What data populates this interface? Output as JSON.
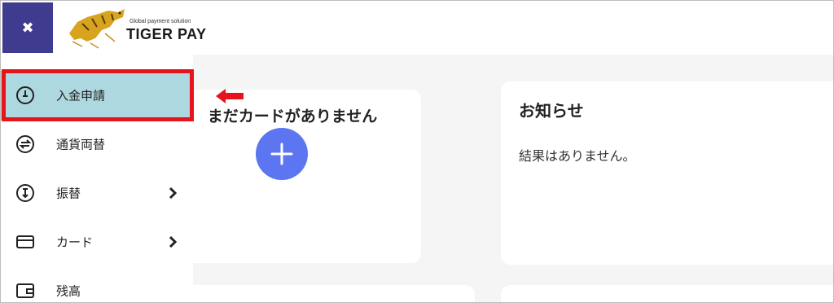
{
  "header": {
    "close_icon": "close-icon",
    "logo_tagline": "Global payment solution",
    "logo_name": "TIGER PAY"
  },
  "sidebar": {
    "items": [
      {
        "label": "入金申請",
        "icon": "deposit-clock-icon",
        "has_submenu": false,
        "active": true
      },
      {
        "label": "通貨両替",
        "icon": "exchange-icon",
        "has_submenu": false,
        "active": false
      },
      {
        "label": "振替",
        "icon": "transfer-icon",
        "has_submenu": true,
        "active": false
      },
      {
        "label": "カード",
        "icon": "card-icon",
        "has_submenu": true,
        "active": false
      },
      {
        "label": "残高",
        "icon": "wallet-icon",
        "has_submenu": false,
        "active": false
      }
    ]
  },
  "cards_panel": {
    "empty_title": "まだカードがありません",
    "add_icon": "plus-icon"
  },
  "news_panel": {
    "title": "お知らせ",
    "empty_message": "結果はありません。"
  },
  "colors": {
    "close_button_bg": "#3f3b8f",
    "active_item_bg": "#aed8df",
    "highlight_red": "#e8141b",
    "add_button_blue": "#5b76f0"
  }
}
